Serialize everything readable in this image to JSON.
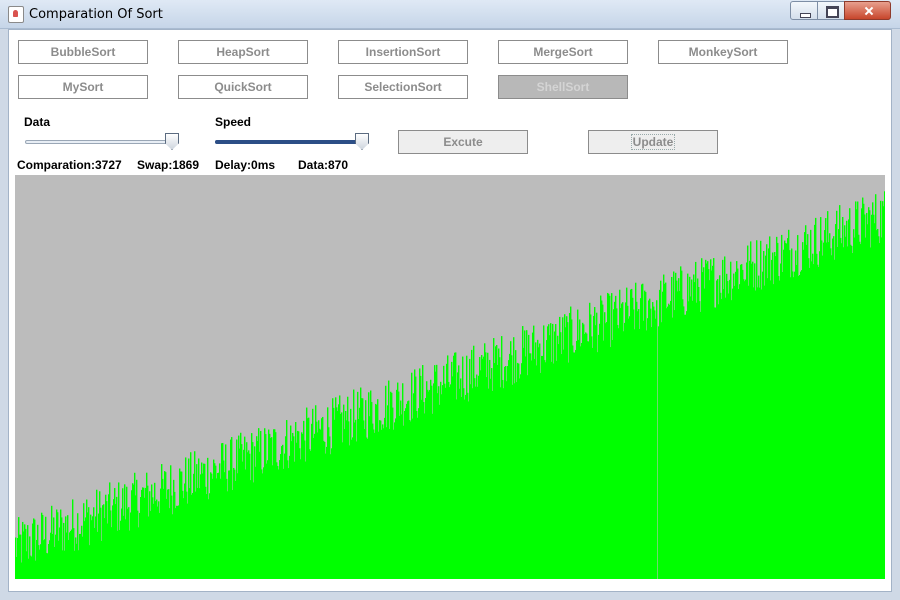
{
  "window": {
    "title": "Comparation Of Sort"
  },
  "sort_buttons": [
    {
      "label": "BubbleSort"
    },
    {
      "label": "HeapSort"
    },
    {
      "label": "InsertionSort"
    },
    {
      "label": "MergeSort"
    },
    {
      "label": "MonkeySort"
    },
    {
      "label": "MySort"
    },
    {
      "label": "QuickSort"
    },
    {
      "label": "SelectionSort"
    },
    {
      "label": "ShellSort",
      "selected": true
    }
  ],
  "controls": {
    "data_label": "Data",
    "speed_label": "Speed",
    "data_slider_value": 1.0,
    "speed_slider_value": 1.0,
    "execute_label": "Excute",
    "update_label": "Update"
  },
  "stats": {
    "comparation": "Comparation:3727",
    "swap": "Swap:1869",
    "delay": "Delay:0ms",
    "data": "Data:870"
  },
  "visualization": {
    "bar_count": 870,
    "bar_color": "#00ff00",
    "background_color": "#bcbcbc"
  }
}
